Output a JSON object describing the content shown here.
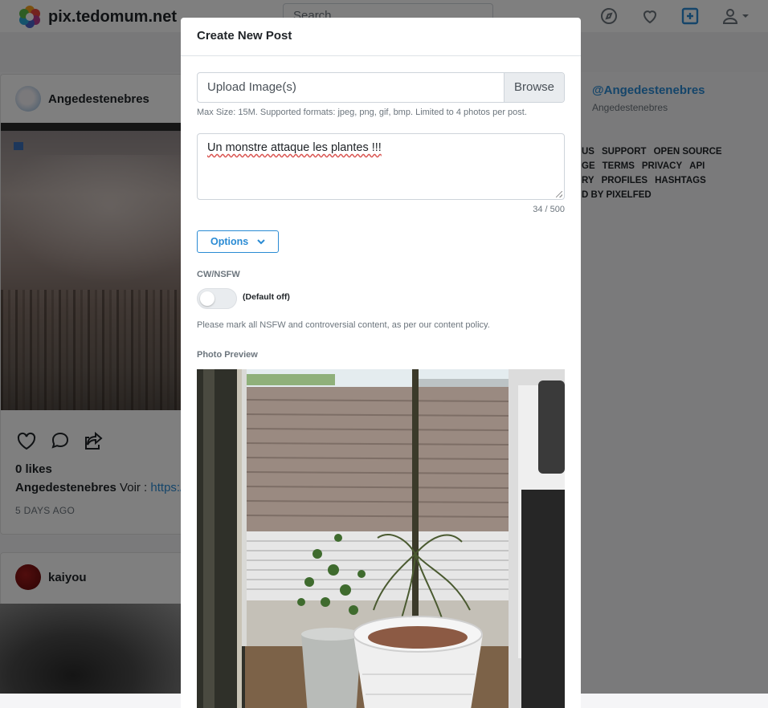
{
  "navbar": {
    "site_name": "pix.tedomum.net",
    "search_placeholder": "Search",
    "icons": [
      "compass-icon",
      "heart-icon",
      "plus-square-icon",
      "user-icon",
      "caret-down-icon"
    ]
  },
  "feed": {
    "posts": [
      {
        "username": "Angedestenebres",
        "likes": "0 likes",
        "caption_author": "Angedestenebres",
        "caption_text": "Voir :",
        "caption_link": "https://",
        "timestamp": "5 DAYS AGO"
      },
      {
        "username": "kaiyou"
      }
    ]
  },
  "sidebar": {
    "handle": "@Angedestenebres",
    "name": "Angedestenebres",
    "footer_links": [
      "US",
      "SUPPORT",
      "OPEN SOURCE",
      "GE",
      "TERMS",
      "PRIVACY",
      "API",
      "RY",
      "PROFILES",
      "HASHTAGS",
      "D BY PIXELFED"
    ]
  },
  "modal": {
    "title": "Create New Post",
    "upload_label": "Upload Image(s)",
    "browse_label": "Browse",
    "upload_hint": "Max Size: 15M. Supported formats: jpeg, png, gif, bmp. Limited to 4 photos per post.",
    "caption_value": "Un monstre attaque les plantes !!!",
    "char_counter": "34 / 500",
    "options_label": "Options",
    "cw_label": "CW/NSFW",
    "cw_default": "(Default off)",
    "cw_enabled": false,
    "policy_text": "Please mark all NSFW and controversial content, as per our content policy.",
    "preview_label": "Photo Preview"
  },
  "colors": {
    "accent": "#2a8bd4",
    "backdrop": "rgba(0,0,0,0.5)"
  }
}
